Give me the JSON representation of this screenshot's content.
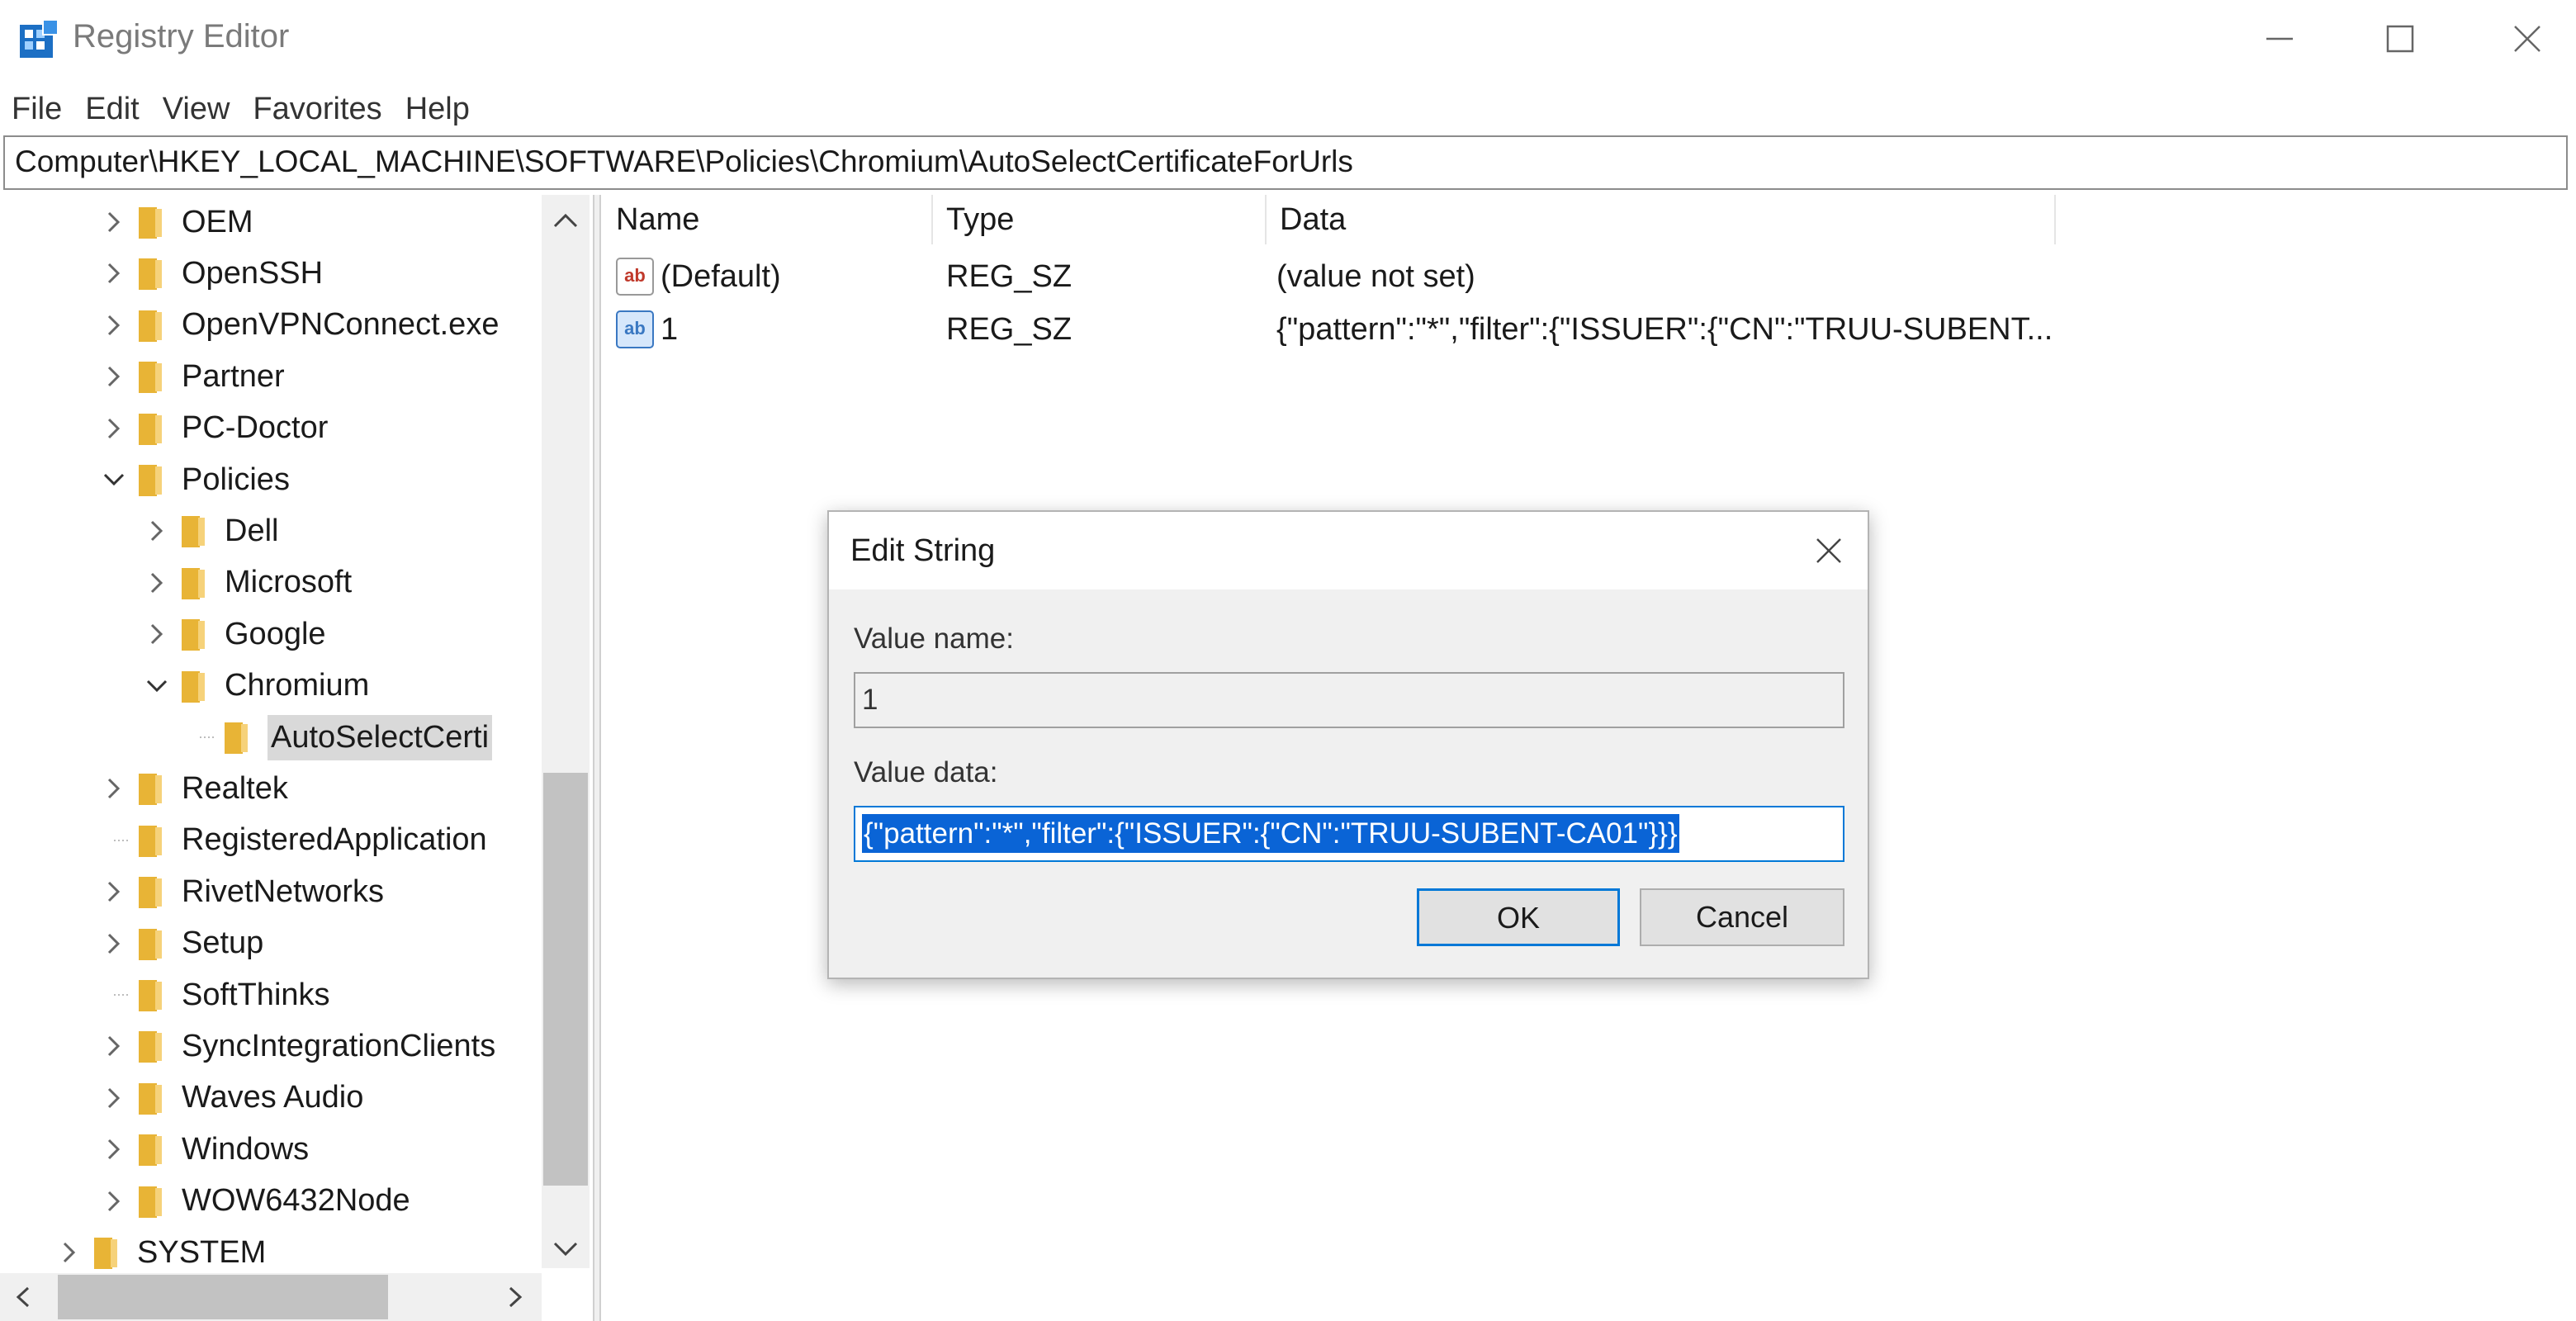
{
  "window": {
    "title": "Registry Editor"
  },
  "menu": [
    "File",
    "Edit",
    "View",
    "Favorites",
    "Help"
  ],
  "address": "Computer\\HKEY_LOCAL_MACHINE\\SOFTWARE\\Policies\\Chromium\\AutoSelectCertificateForUrls",
  "tree": {
    "items": [
      {
        "label": "OEM",
        "expander": "collapsed"
      },
      {
        "label": "OpenSSH",
        "expander": "collapsed"
      },
      {
        "label": "OpenVPNConnect.exe",
        "expander": "collapsed"
      },
      {
        "label": "Partner",
        "expander": "collapsed"
      },
      {
        "label": "PC-Doctor",
        "expander": "collapsed"
      },
      {
        "label": "Policies",
        "expander": "expanded"
      },
      {
        "label": "Dell",
        "expander": "collapsed"
      },
      {
        "label": "Microsoft",
        "expander": "collapsed"
      },
      {
        "label": "Google",
        "expander": "collapsed"
      },
      {
        "label": "Chromium",
        "expander": "expanded"
      },
      {
        "label": "AutoSelectCerti",
        "expander": "none",
        "selected": true
      },
      {
        "label": "Realtek",
        "expander": "collapsed"
      },
      {
        "label": "RegisteredApplication",
        "expander": "none"
      },
      {
        "label": "RivetNetworks",
        "expander": "collapsed"
      },
      {
        "label": "Setup",
        "expander": "collapsed"
      },
      {
        "label": "SoftThinks",
        "expander": "none"
      },
      {
        "label": "SyncIntegrationClients",
        "expander": "collapsed"
      },
      {
        "label": "Waves Audio",
        "expander": "collapsed"
      },
      {
        "label": "Windows",
        "expander": "collapsed"
      },
      {
        "label": "WOW6432Node",
        "expander": "collapsed"
      },
      {
        "label": "SYSTEM",
        "expander": "collapsed"
      }
    ]
  },
  "list": {
    "columns": [
      "Name",
      "Type",
      "Data"
    ],
    "rows": [
      {
        "name": "(Default)",
        "type": "REG_SZ",
        "data": "(value not set)"
      },
      {
        "name": "1",
        "type": "REG_SZ",
        "data": "{\"pattern\":\"*\",\"filter\":{\"ISSUER\":{\"CN\":\"TRUU-SUBENT..."
      }
    ]
  },
  "dialog": {
    "title": "Edit String",
    "value_name_label": "Value name:",
    "value_name": "1",
    "value_data_label": "Value data:",
    "value_data": "{\"pattern\":\"*\",\"filter\":{\"ISSUER\":{\"CN\":\"TRUU-SUBENT-CA01\"}}}",
    "ok": "OK",
    "cancel": "Cancel"
  },
  "colors": {
    "folder": "#e8b436",
    "selection": "#0a64d6",
    "focus_border": "#0078d7",
    "icon_string_red": "#c0392b",
    "icon_string_blue": "#3a78c2"
  },
  "icons": [
    "regedit-app-icon",
    "minimize-icon",
    "maximize-icon",
    "close-icon",
    "folder-icon",
    "chevron-right-icon",
    "chevron-down-icon",
    "string-value-icon",
    "scroll-up-icon",
    "scroll-down-icon",
    "scroll-left-icon",
    "scroll-right-icon"
  ]
}
